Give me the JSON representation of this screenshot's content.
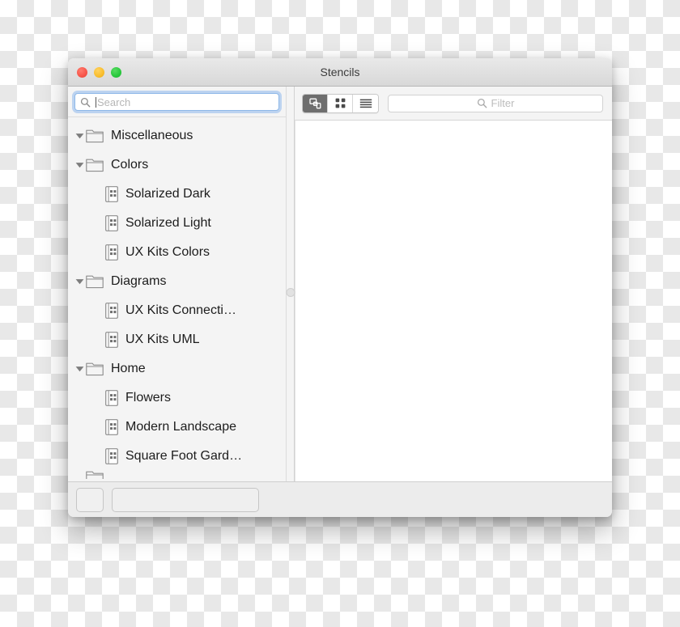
{
  "window": {
    "title": "Stencils",
    "traffic_lights": [
      {
        "name": "close",
        "color": "#f75549"
      },
      {
        "name": "minimize",
        "color": "#f9bd2c"
      },
      {
        "name": "zoom",
        "color": "#28c83c"
      }
    ]
  },
  "sidebar": {
    "search": {
      "placeholder": "Search",
      "value": "",
      "icon": "search-icon",
      "focused": true
    },
    "tree": [
      {
        "label": "Miscellaneous",
        "type": "folder",
        "icon": "folder-icon",
        "depth": 0,
        "expanded": true,
        "truncated": false
      },
      {
        "label": "Colors",
        "type": "folder",
        "icon": "folder-icon",
        "depth": 0,
        "expanded": true,
        "truncated": false
      },
      {
        "label": "Solarized Dark",
        "type": "stencil",
        "icon": "stencil-icon",
        "depth": 1,
        "expanded": false,
        "truncated": false
      },
      {
        "label": "Solarized Light",
        "type": "stencil",
        "icon": "stencil-icon",
        "depth": 1,
        "expanded": false,
        "truncated": false
      },
      {
        "label": "UX Kits Colors",
        "type": "stencil",
        "icon": "stencil-icon",
        "depth": 1,
        "expanded": false,
        "truncated": false
      },
      {
        "label": "Diagrams",
        "type": "folder",
        "icon": "folder-icon",
        "depth": 0,
        "expanded": true,
        "truncated": false
      },
      {
        "label": "UX Kits Connecti…",
        "type": "stencil",
        "icon": "stencil-icon",
        "depth": 1,
        "expanded": false,
        "truncated": true
      },
      {
        "label": "UX Kits UML",
        "type": "stencil",
        "icon": "stencil-icon",
        "depth": 1,
        "expanded": false,
        "truncated": false
      },
      {
        "label": "Home",
        "type": "folder",
        "icon": "folder-icon",
        "depth": 0,
        "expanded": true,
        "truncated": false
      },
      {
        "label": "Flowers",
        "type": "stencil",
        "icon": "stencil-icon",
        "depth": 1,
        "expanded": false,
        "truncated": false
      },
      {
        "label": "Modern Landscape",
        "type": "stencil",
        "icon": "stencil-icon",
        "depth": 1,
        "expanded": false,
        "truncated": false
      },
      {
        "label": "Square Foot Gard…",
        "type": "stencil",
        "icon": "stencil-icon",
        "depth": 1,
        "expanded": false,
        "truncated": true
      }
    ]
  },
  "toolbar": {
    "view_modes": [
      {
        "name": "stencil-view",
        "icon": "overlapping-shapes-icon",
        "selected": true
      },
      {
        "name": "grid-view",
        "icon": "grid-icon",
        "selected": false
      },
      {
        "name": "list-view",
        "icon": "list-icon",
        "selected": false
      }
    ],
    "filter": {
      "placeholder": "Filter",
      "value": "",
      "icon": "search-icon"
    }
  },
  "bottom_bar": {
    "action_button_label": "",
    "combo_value": ""
  },
  "colors": {
    "selected_segment": "#6e6e6e",
    "focus_ring": "#78aaeb",
    "window_chrome": "#ececec",
    "sidebar_bg": "#f4f4f4",
    "canvas_bg": "#ffffff"
  }
}
